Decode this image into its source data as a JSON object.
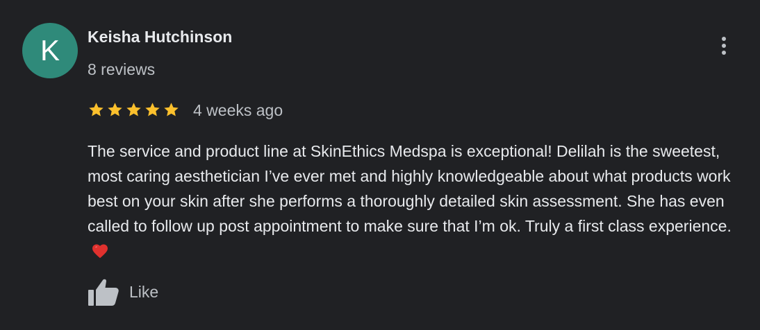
{
  "review": {
    "avatar_letter": "K",
    "avatar_color": "#2f8a7a",
    "author_name": "Keisha Hutchinson",
    "author_reviews": "8 reviews",
    "rating": 5,
    "rating_max": 5,
    "star_color": "#fbc02d",
    "time_ago": "4 weeks ago",
    "text": "The service and product line at SkinEthics Medspa is exceptional! Delilah is the sweetest, most caring aesthetician I’ve ever met and highly knowledgeable about what products work best on your skin after she performs a thoroughly detailed skin assessment. She has even called to follow up post appointment to make sure that I’m ok. Truly a first class experience.",
    "text_emoji": "heart-emoji",
    "like_label": "Like",
    "like_icon": "thumbs-up-icon",
    "more_icon": "more-vert-icon"
  }
}
